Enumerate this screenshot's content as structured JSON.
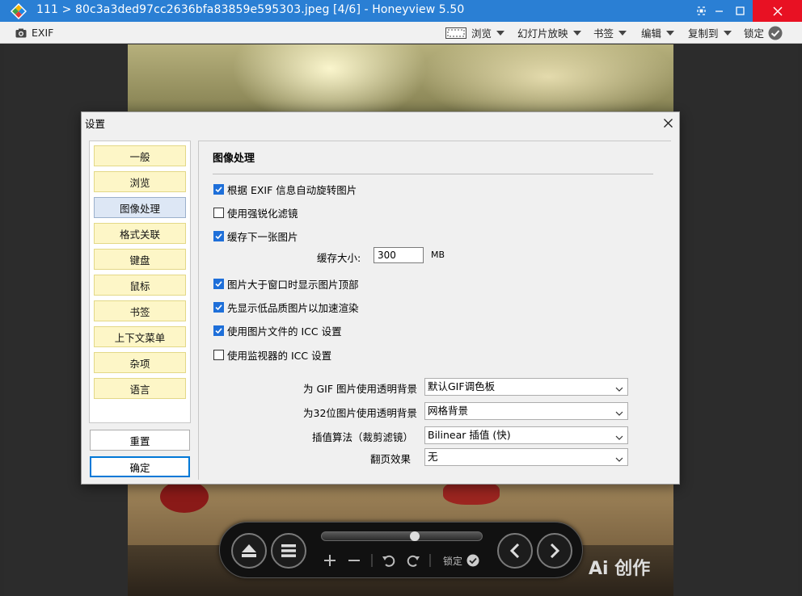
{
  "window": {
    "title": "111 > 80c3a3ded97cc2636bfa83859e595303.jpeg [4/6] - Honeyview 5.50"
  },
  "toolbar": {
    "exif_label": "EXIF",
    "browse_label": "浏览",
    "slideshow_label": "幻灯片放映",
    "bookmark_label": "书签",
    "edit_label": "编辑",
    "copy_to_label": "复制到",
    "lock_label": "锁定"
  },
  "controls": {
    "lock_label": "锁定",
    "slider_position": 0.58
  },
  "watermark": {
    "text": "Ai 创作"
  },
  "dialog": {
    "title": "设置",
    "nav": [
      {
        "label": "一般"
      },
      {
        "label": "浏览"
      },
      {
        "label": "图像处理"
      },
      {
        "label": "格式关联"
      },
      {
        "label": "键盘"
      },
      {
        "label": "鼠标"
      },
      {
        "label": "书签"
      },
      {
        "label": "上下文菜单"
      },
      {
        "label": "杂项"
      },
      {
        "label": "语言"
      }
    ],
    "active_nav_index": 2,
    "reset_label": "重置",
    "ok_label": "确定",
    "panel": {
      "title": "图像处理",
      "checkboxes": [
        {
          "label": "根据 EXIF 信息自动旋转图片",
          "checked": true
        },
        {
          "label": "使用强锐化滤镜",
          "checked": false
        },
        {
          "label": "缓存下一张图片",
          "checked": true
        },
        {
          "label": "图片大于窗口时显示图片顶部",
          "checked": true
        },
        {
          "label": "先显示低品质图片以加速渲染",
          "checked": true
        },
        {
          "label": "使用图片文件的 ICC 设置",
          "checked": true
        },
        {
          "label": "使用监视器的 ICC 设置",
          "checked": false
        }
      ],
      "cache_size_label": "缓存大小:",
      "cache_size_value": "300",
      "cache_size_unit": "MB",
      "selects": [
        {
          "label": "为 GIF 图片使用透明背景",
          "value": "默认GIF调色板"
        },
        {
          "label": "为32位图片使用透明背景",
          "value": "网格背景"
        },
        {
          "label": "插值算法（裁剪滤镜）",
          "value": "Bilinear 插值 (快)"
        },
        {
          "label": "翻页效果",
          "value": "无"
        }
      ]
    }
  },
  "colors": {
    "titlebar": "#2a7fd4",
    "close_button": "#e81123",
    "nav_item_bg": "#fdf6c7",
    "nav_active_bg": "#dde7f5",
    "checkbox_checked": "#1e6fd9"
  }
}
